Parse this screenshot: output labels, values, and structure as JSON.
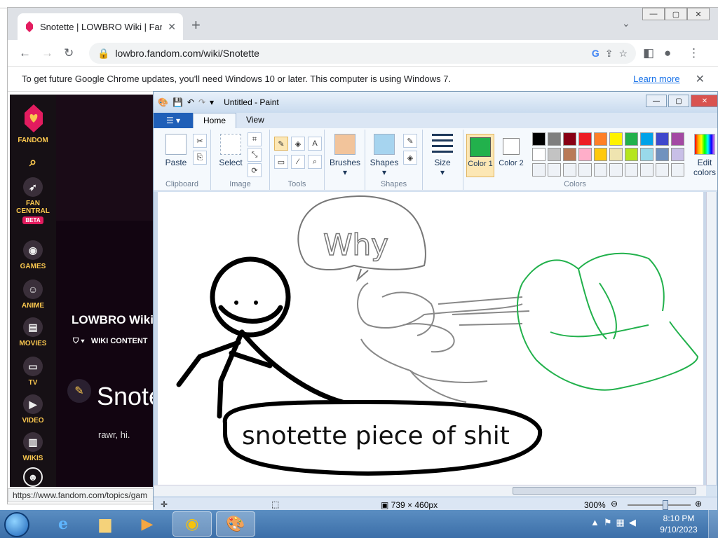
{
  "browser": {
    "tab_title": "Snotette | LOWBRO Wiki | Fandom",
    "url": "lowbro.fandom.com/wiki/Snotette",
    "info_message": "To get future Google Chrome updates, you'll need Windows 10 or later. This computer is using Windows 7.",
    "info_link": "Learn more",
    "status_url": "https://www.fandom.com/topics/gam"
  },
  "fandom": {
    "logo_label": "FANDOM",
    "rail": [
      {
        "label": "FAN CENTRAL",
        "icon": "rocket-icon"
      },
      {
        "label": "GAMES",
        "icon": "gamepad-icon"
      },
      {
        "label": "ANIME",
        "icon": "anime-icon"
      },
      {
        "label": "MOVIES",
        "icon": "clapper-icon"
      },
      {
        "label": "TV",
        "icon": "tv-icon"
      },
      {
        "label": "VIDEO",
        "icon": "video-icon"
      },
      {
        "label": "WIKIS",
        "icon": "book-icon"
      }
    ],
    "beta": "BETA",
    "wiki_title": "LOWBRO Wiki",
    "wiki_nav": "WIKI CONTENT",
    "page_title": "Snotette",
    "page_body": "rawr, hi."
  },
  "paint": {
    "title": "Untitled - Paint",
    "file_tab": "",
    "tabs": [
      "Home",
      "View"
    ],
    "groups": {
      "clipboard": "Clipboard",
      "image": "Image",
      "tools": "Tools",
      "shapes": "Shapes",
      "colors": "Colors"
    },
    "buttons": {
      "paste": "Paste",
      "select": "Select",
      "brushes": "Brushes",
      "shapes": "Shapes",
      "size": "Size",
      "color1": "Color 1",
      "color2": "Color 2",
      "edit_colors": "Edit colors"
    },
    "dimensions": "739 × 460px",
    "zoom": "300%",
    "drawing_text": "snotette piece of shit",
    "drawing_bubble": "Why",
    "palette": [
      "#000000",
      "#7f7f7f",
      "#880015",
      "#ed1c24",
      "#ff7f27",
      "#fff200",
      "#22b14c",
      "#00a2e8",
      "#3f48cc",
      "#a349a4",
      "#ffffff",
      "#c3c3c3",
      "#b97a57",
      "#ffaec9",
      "#ffc90e",
      "#efe4b0",
      "#b5e61d",
      "#99d9ea",
      "#7092be",
      "#c8bfe7"
    ],
    "color1_value": "#22b14c"
  },
  "taskbar": {
    "time": "8:10 PM",
    "date": "9/10/2023"
  }
}
